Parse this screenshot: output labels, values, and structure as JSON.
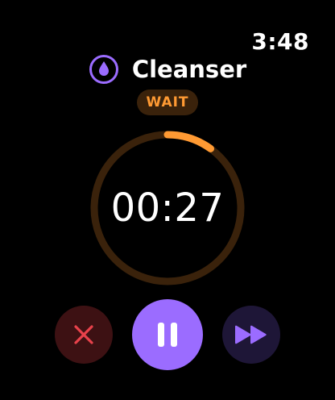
{
  "status_bar": {
    "time": "3:48"
  },
  "header": {
    "icon": "water-drop-icon",
    "title": "Cleanser"
  },
  "badge": {
    "label": "WAIT"
  },
  "timer": {
    "display": "00:27",
    "progress_fraction": 0.1
  },
  "controls": {
    "cancel_icon": "close-icon",
    "pause_icon": "pause-icon",
    "skip_icon": "fast-forward-icon"
  },
  "colors": {
    "accent_purple": "#9b6cff",
    "wait_orange": "#ff9a33",
    "ring_track": "#3a220b",
    "cancel_red": "#e8424b",
    "cancel_bg": "#3d1113",
    "skip_bg": "#1e1637"
  }
}
